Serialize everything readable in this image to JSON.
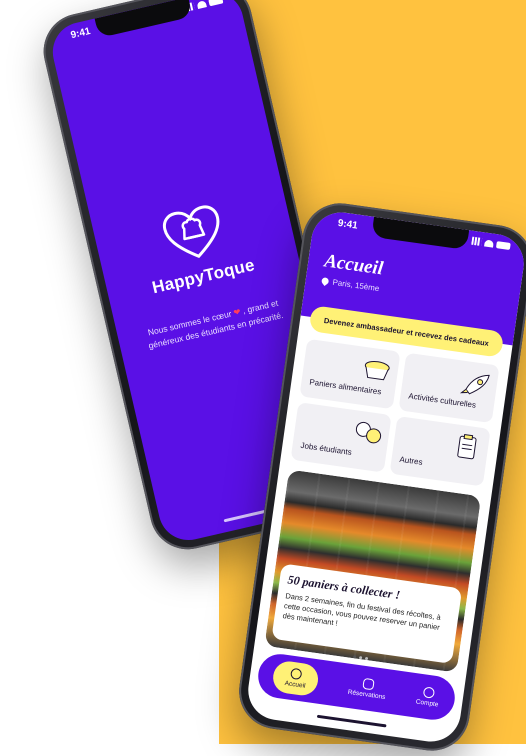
{
  "colors": {
    "primary": "#5a10e6",
    "accent": "#fff176",
    "background": "#ffc23f"
  },
  "splash": {
    "status_time": "9:41",
    "brand": "HappyToque",
    "tagline_part1": "Nous sommes le cœur",
    "tagline_part2": ", grand et généreux des étudiants en précarité.",
    "logo_icon": "heart-chef-hat-icon"
  },
  "home": {
    "status_time": "9:41",
    "title": "Accueil",
    "location": "Paris, 15ème",
    "ambassador_banner": "Devenez ambassadeur et recevez des cadeaux",
    "categories": [
      {
        "label": "Paniers alimentaires",
        "icon": "food-basket-icon"
      },
      {
        "label": "Activités culturelles",
        "icon": "rocket-icon"
      },
      {
        "label": "Jobs étudiants",
        "icon": "chat-bubbles-icon"
      },
      {
        "label": "Autres",
        "icon": "clipboard-icon"
      }
    ],
    "promo": {
      "title": "50 paniers à collecter !",
      "text": "Dans 2 semaines, fin du festival des récoltes, à cette occasion, vous pouvez reserver un panier dès maintenant !"
    },
    "tabs": [
      {
        "label": "Accueil",
        "icon": "home-icon",
        "active": true
      },
      {
        "label": "Réservations",
        "icon": "basket-icon",
        "active": false
      },
      {
        "label": "Compte",
        "icon": "user-icon",
        "active": false
      }
    ]
  }
}
